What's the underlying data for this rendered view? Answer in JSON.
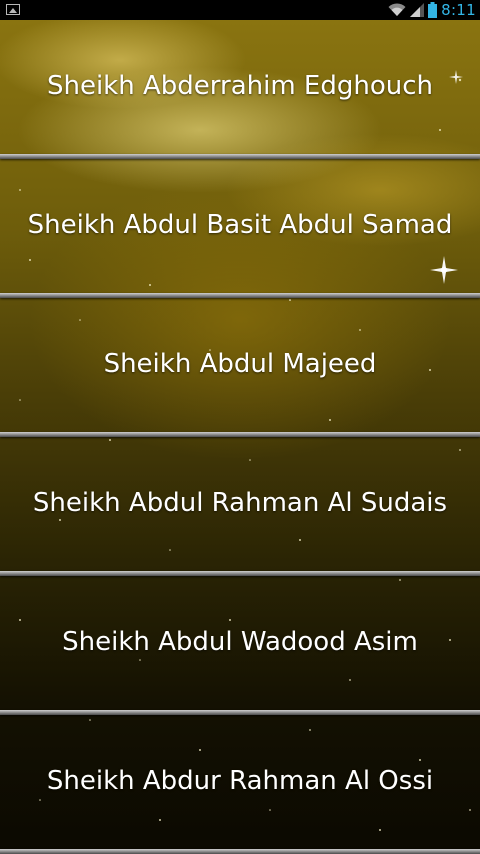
{
  "status_bar": {
    "time": "8:11",
    "icons": [
      "image-notification-icon",
      "wifi-icon",
      "signal-icon",
      "battery-icon"
    ],
    "time_color": "#33b5e5"
  },
  "reciters": [
    {
      "label": "Sheikh Abderrahim Edghouch"
    },
    {
      "label": "Sheikh Abdul Basit Abdul Samad"
    },
    {
      "label": "Sheikh Abdul Majeed"
    },
    {
      "label": "Sheikh Abdul Rahman Al Sudais"
    },
    {
      "label": "Sheikh Abdul Wadood Asim"
    },
    {
      "label": "Sheikh Abdur Rahman Al Ossi"
    }
  ]
}
